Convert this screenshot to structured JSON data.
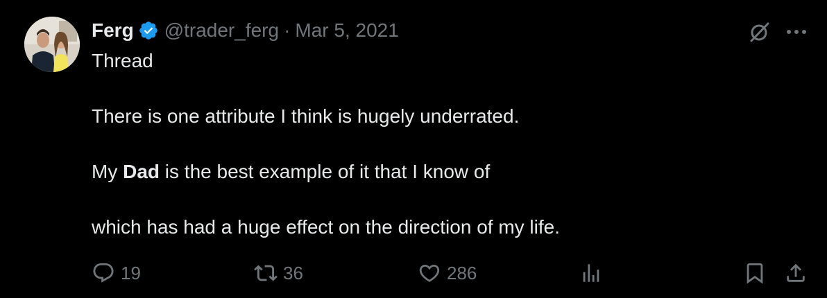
{
  "author": {
    "name": "Ferg",
    "handle": "@trader_ferg",
    "separator": "·",
    "date": "Mar 5, 2021"
  },
  "icons": {
    "verified": "verified-badge-icon",
    "grok": "grok-icon",
    "more": "more-icon"
  },
  "tweet": {
    "line1": "Thread",
    "line2": "There is one attribute I think is hugely underrated.",
    "line3_prefix": "My ",
    "line3_bold": "Dad",
    "line3_suffix": " is the best example of it that I know of",
    "line4": "which has had a huge effect on the direction of my life."
  },
  "metrics": {
    "replies": "19",
    "retweets": "36",
    "likes": "286"
  },
  "colors": {
    "background": "#000000",
    "text": "#e7e9ea",
    "muted": "#71767b",
    "verified": "#1d9bf0"
  }
}
